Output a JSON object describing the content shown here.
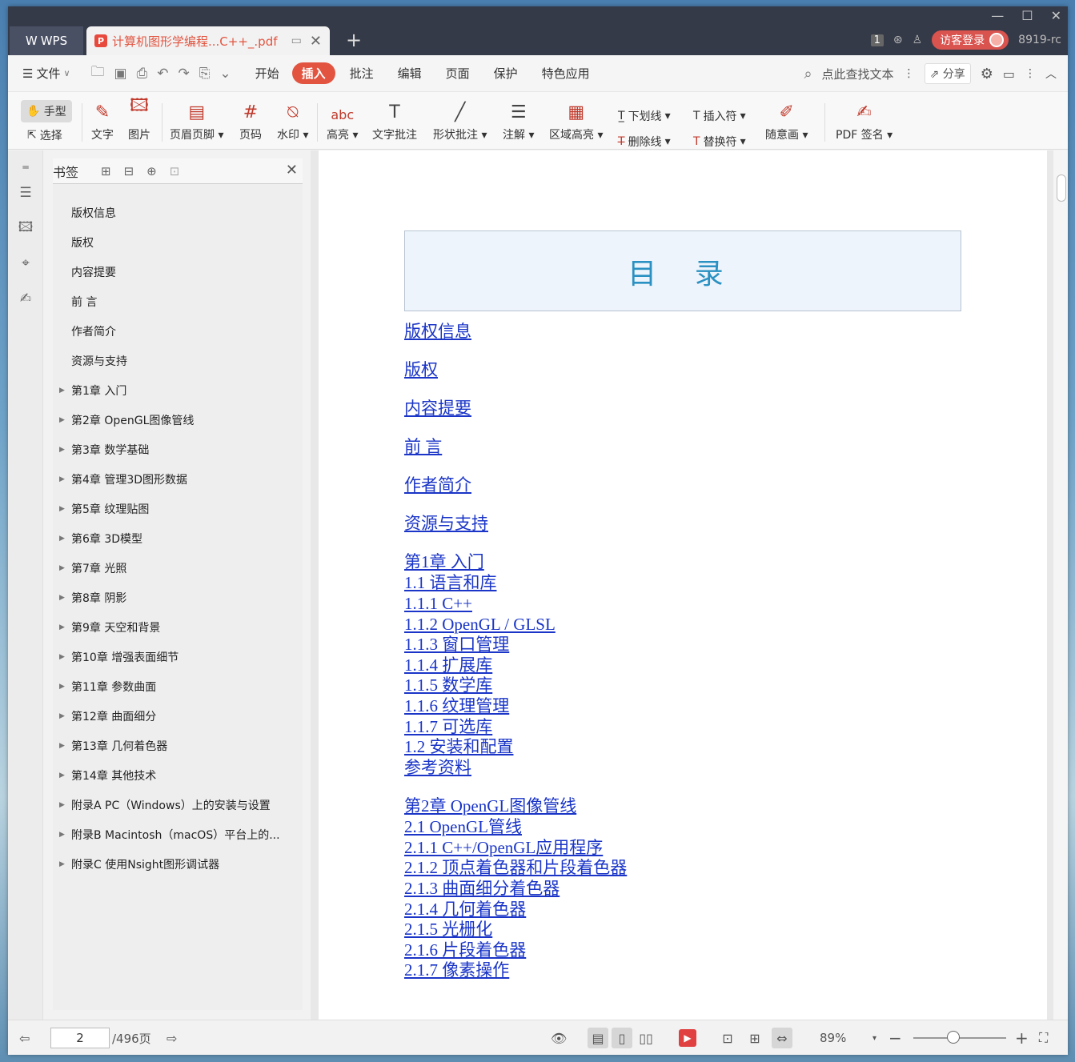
{
  "titlebar": {
    "app_tab": "WPS",
    "doc_tab": "计算机图形学编程...C++_.pdf",
    "page_badge": "1",
    "login": "访客登录",
    "user_id": "8919-rc"
  },
  "menubar": {
    "file": "文件",
    "items": [
      "开始",
      "插入",
      "批注",
      "编辑",
      "页面",
      "保护",
      "特色应用"
    ],
    "active": "插入",
    "search": "点此查找文本",
    "share": "分享"
  },
  "ribbon": {
    "hand": "手型",
    "select": "选择",
    "text": "文字",
    "image": "图片",
    "header_footer": "页眉页脚",
    "page_num": "页码",
    "watermark": "水印",
    "highlight": "高亮",
    "text_comment": "文字批注",
    "shape_comment": "形状批注",
    "note": "注解",
    "area_highlight": "区域高亮",
    "underline": "下划线",
    "strikethrough": "删除线",
    "insert_mark": "插入符",
    "replace_mark": "替换符",
    "freehand": "随意画",
    "pdf_sign": "PDF 签名"
  },
  "bookmarks": {
    "title": "书签",
    "items": [
      {
        "label": "版权信息",
        "expandable": false
      },
      {
        "label": "版权",
        "expandable": false
      },
      {
        "label": "内容提要",
        "expandable": false
      },
      {
        "label": "前 言",
        "expandable": false
      },
      {
        "label": "作者简介",
        "expandable": false
      },
      {
        "label": "资源与支持",
        "expandable": false
      },
      {
        "label": "第1章 入门",
        "expandable": true
      },
      {
        "label": "第2章 OpenGL图像管线",
        "expandable": true
      },
      {
        "label": "第3章 数学基础",
        "expandable": true
      },
      {
        "label": "第4章 管理3D图形数据",
        "expandable": true
      },
      {
        "label": "第5章 纹理贴图",
        "expandable": true
      },
      {
        "label": "第6章 3D模型",
        "expandable": true
      },
      {
        "label": "第7章 光照",
        "expandable": true
      },
      {
        "label": "第8章 阴影",
        "expandable": true
      },
      {
        "label": "第9章 天空和背景",
        "expandable": true
      },
      {
        "label": "第10章 增强表面细节",
        "expandable": true
      },
      {
        "label": "第11章 参数曲面",
        "expandable": true
      },
      {
        "label": "第12章 曲面细分",
        "expandable": true
      },
      {
        "label": "第13章 几何着色器",
        "expandable": true
      },
      {
        "label": "第14章 其他技术",
        "expandable": true
      },
      {
        "label": "附录A PC（Windows）上的安装与设置",
        "expandable": true
      },
      {
        "label": "附录B Macintosh（macOS）平台上的...",
        "expandable": true
      },
      {
        "label": "附录C 使用Nsight图形调试器",
        "expandable": true
      }
    ]
  },
  "document": {
    "toc_title": "目 录",
    "links": [
      "版权信息",
      "版权",
      "内容提要",
      "前 言",
      "作者简介",
      "资源与支持",
      "第1章 入门",
      "1.1 语言和库",
      "1.1.1 C++",
      "1.1.2 OpenGL / GLSL",
      "1.1.3 窗口管理",
      "1.1.4 扩展库",
      "1.1.5 数学库",
      "1.1.6 纹理管理",
      "1.1.7 可选库",
      "1.2 安装和配置",
      "参考资料",
      "第2章 OpenGL图像管线",
      "2.1 OpenGL管线",
      "2.1.1 C++/OpenGL应用程序",
      "2.1.2 顶点着色器和片段着色器",
      "2.1.3 曲面细分着色器",
      "2.1.4 几何着色器",
      "2.1.5 光栅化",
      "2.1.6 片段着色器",
      "2.1.7 像素操作"
    ]
  },
  "statusbar": {
    "page_current": "2",
    "page_total": "/496页",
    "zoom": "89%"
  }
}
